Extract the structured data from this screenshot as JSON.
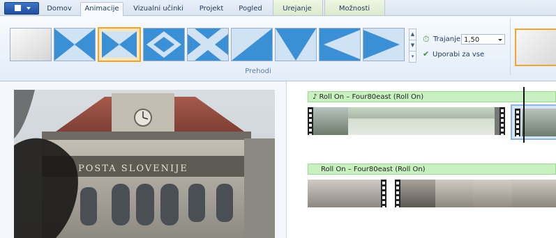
{
  "ribbon_tabs": [
    "Domov",
    "Animacije",
    "Vizualni učinki",
    "Projekt",
    "Pogled",
    "Urejanje",
    "Možnosti"
  ],
  "active_tab": "Animacije",
  "transitions_group_label": "Prehodi",
  "duration": {
    "label": "Trajanje:",
    "value": "1,50"
  },
  "apply_all_label": "Uporabi za vse",
  "storyboard": {
    "clip1_audio": "♪ Roll On – Four80east (Roll On)",
    "clip2_audio": "Roll On – Four80east (Roll On)"
  },
  "video_text": "POSTA SLOVENIJE",
  "colors": {
    "accent_selected": "#f0a531",
    "audio_bar": "#c8f0c0",
    "ribbon_text": "#1e395b"
  }
}
